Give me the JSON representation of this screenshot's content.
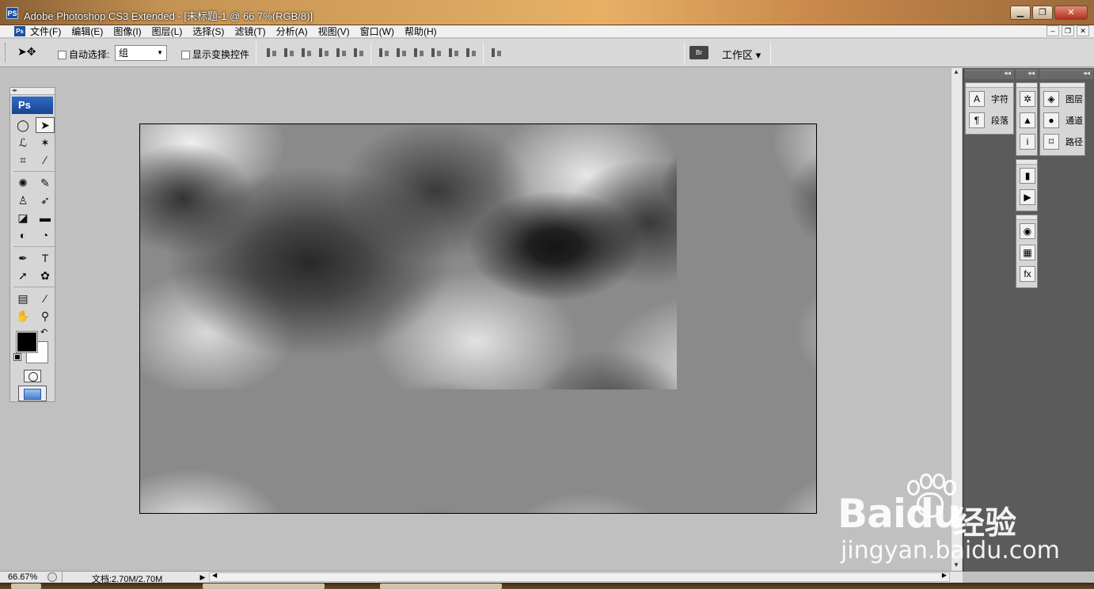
{
  "window": {
    "app_icon": "PS",
    "title": "Adobe Photoshop CS3 Extended - [未标题-1 @ 66.7%(RGB/8)]",
    "min": "▁",
    "restore": "❐",
    "close": "✕"
  },
  "menu": {
    "icon": "Ps",
    "items": [
      "文件(F)",
      "编辑(E)",
      "图像(I)",
      "图层(L)",
      "选择(S)",
      "滤镜(T)",
      "分析(A)",
      "视图(V)",
      "窗口(W)",
      "帮助(H)"
    ],
    "doc_min": "–",
    "doc_restore": "❐",
    "doc_close": "✕"
  },
  "options": {
    "tool_glyph": "➤✥",
    "auto_select_label": "自动选择:",
    "group_value": "组",
    "show_transform_label": "显示变换控件",
    "bridge_label": "Br",
    "workspace_label": "工作区 ▾"
  },
  "tools": {
    "panel_grip": "◂▸",
    "badge": "Ps",
    "swap": "↶"
  },
  "dock": {
    "collapse": "◂◂",
    "group1": [
      {
        "icon": "A",
        "label": "字符"
      },
      {
        "icon": "¶",
        "label": "段落"
      }
    ],
    "group2_icons": [
      "✲",
      "▲",
      "i"
    ],
    "group3": [
      {
        "icon": "◈",
        "label": "图层"
      },
      {
        "icon": "●",
        "label": "通道"
      },
      {
        "icon": "⌑",
        "label": "路径"
      }
    ],
    "group4_icons": [
      "▮",
      "▶"
    ],
    "group5_icons": [
      "◉",
      "▦",
      "fx"
    ]
  },
  "status": {
    "zoom": "66.67%",
    "doc_info": "文档:2.70M/2.70M",
    "arrow": "▶"
  },
  "watermark": {
    "brand_a": "Bai",
    "brand_b": "du",
    "brand_cn": "经验",
    "url": "jingyan.baidu.com"
  }
}
